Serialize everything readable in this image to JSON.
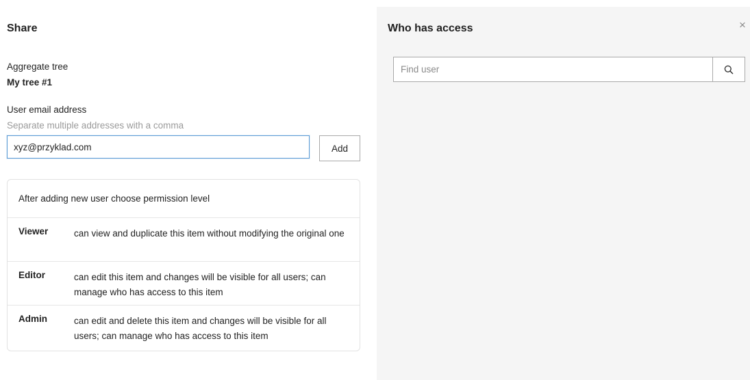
{
  "share": {
    "title": "Share",
    "tree_label": "Aggregate tree",
    "tree_name": "My tree #1",
    "email_label": "User email address",
    "email_hint": "Separate multiple addresses with a comma",
    "email_value": "xyz@przyklad.com",
    "add_label": "Add"
  },
  "permissions": {
    "header": "After adding new user choose permission level",
    "levels": [
      {
        "role": "Viewer",
        "description": "can view and duplicate this item without modifying the original one"
      },
      {
        "role": "Editor",
        "description": "can edit this item and changes will be visible for all users; can manage who has access to this item"
      },
      {
        "role": "Admin",
        "description": "can edit and delete this item and changes will be visible for all users; can manage who has access to this item"
      }
    ]
  },
  "access": {
    "title": "Who has access",
    "close_glyph": "×",
    "find_placeholder": "Find user",
    "find_value": ""
  },
  "icons": {
    "close": "close-icon",
    "search": "search-icon"
  }
}
